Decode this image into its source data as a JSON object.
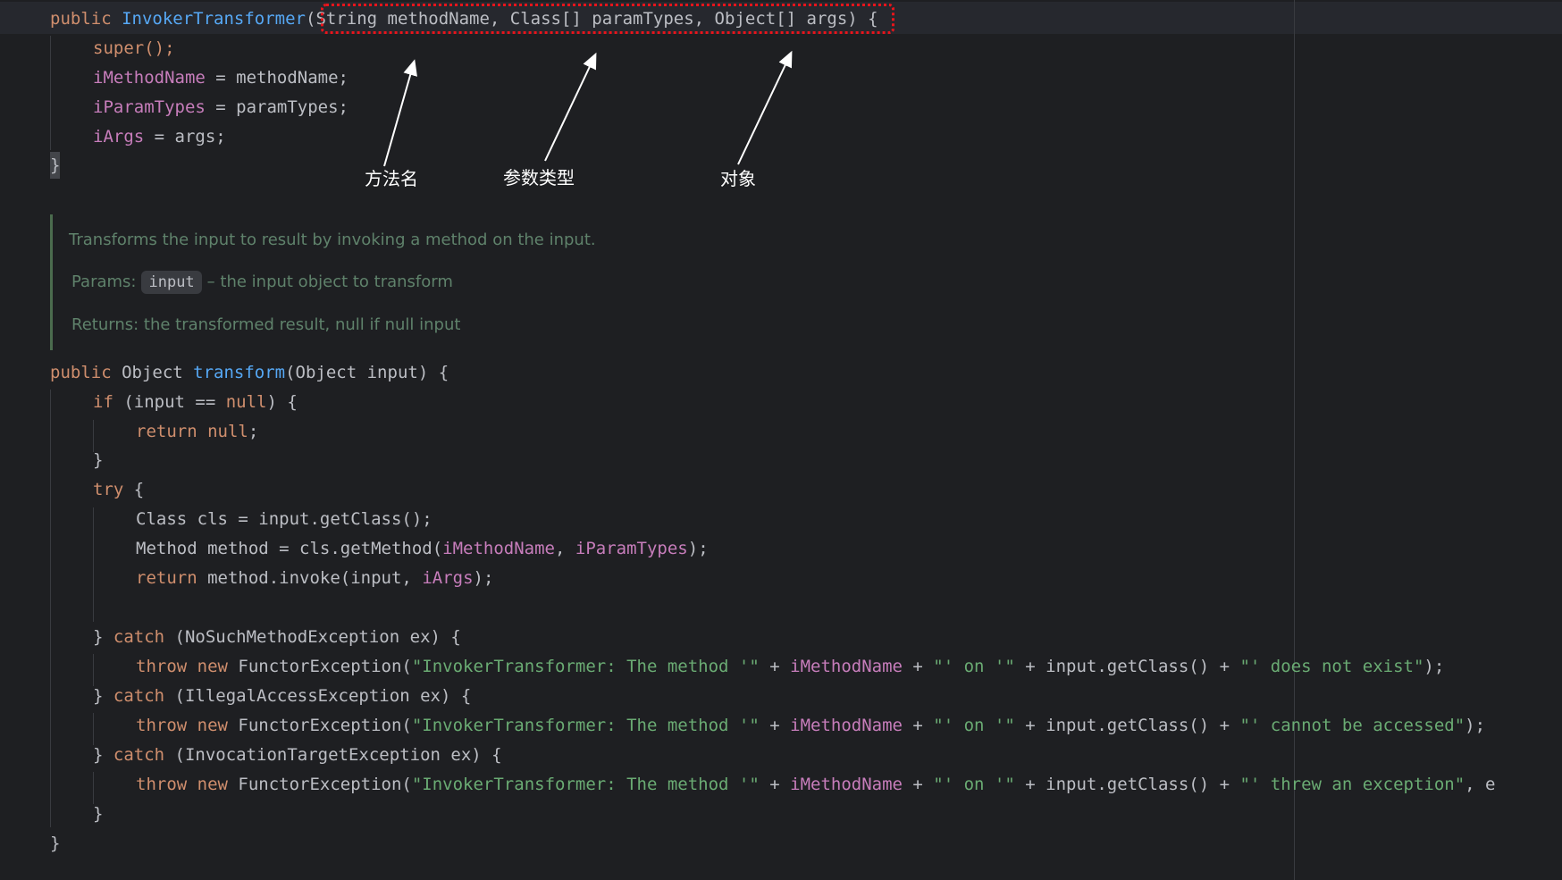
{
  "code": {
    "l1": {
      "kw": "public ",
      "fn": "InvokerTransformer",
      "p1": "(",
      "params": "String methodName, Class[] paramTypes, Object[] args",
      "p2": ")",
      "tail": " {"
    },
    "l2": {
      "text": "super();"
    },
    "l3": {
      "field": "iMethodName",
      "rest": " = methodName;"
    },
    "l4": {
      "field": "iParamTypes",
      "rest": " = paramTypes;"
    },
    "l5": {
      "field": "iArgs",
      "rest": " = args;"
    },
    "l6": {
      "text": "}"
    },
    "doc": {
      "summary": "Transforms the input to result by invoking a method on the input.",
      "params_label": "Params:",
      "param_name": "input",
      "param_desc": "– the input object to transform",
      "returns": "Returns: the transformed result, null if null input"
    },
    "l7": {
      "kw1": "public ",
      "type": "Object ",
      "fn": "transform",
      "rest": "(Object input) {"
    },
    "l8": {
      "kw": "if",
      "a": " (input == ",
      "kw2": "null",
      "b": ") {"
    },
    "l9": {
      "kw": "return null",
      "b": ";"
    },
    "l10": {
      "text": "}"
    },
    "l11": {
      "kw": "try",
      "b": " {"
    },
    "l12": {
      "text": "Class cls = input.getClass();"
    },
    "l13": {
      "a": "Method method = cls.getMethod(",
      "f1": "iMethodName",
      "c": ", ",
      "f2": "iParamTypes",
      "d": ");"
    },
    "l14": {
      "kw": "return",
      "a": " method.invoke(input, ",
      "f": "iArgs",
      "b": ");"
    },
    "l15": {
      "a": "} ",
      "kw": "catch",
      "b": " (NoSuchMethodException ex) {"
    },
    "l16": {
      "kw": "throw new",
      "a": " FunctorException(",
      "s1": "\"InvokerTransformer: The method '\"",
      "b": " + ",
      "f": "iMethodName",
      "c": " + ",
      "s2": "\"' on '\"",
      "d": " + input.getClass() + ",
      "s3": "\"' does not exist\"",
      "e": ");"
    },
    "l17": {
      "a": "} ",
      "kw": "catch",
      "b": " (IllegalAccessException ex) {"
    },
    "l18": {
      "kw": "throw new",
      "a": " FunctorException(",
      "s1": "\"InvokerTransformer: The method '\"",
      "b": " + ",
      "f": "iMethodName",
      "c": " + ",
      "s2": "\"' on '\"",
      "d": " + input.getClass() + ",
      "s3": "\"' cannot be accessed\"",
      "e": ");"
    },
    "l19": {
      "a": "} ",
      "kw": "catch",
      "b": " (InvocationTargetException ex) {"
    },
    "l20": {
      "kw": "throw new",
      "a": " FunctorException(",
      "s1": "\"InvokerTransformer: The method '\"",
      "b": " + ",
      "f": "iMethodName",
      "c": " + ",
      "s2": "\"' on '\"",
      "d": " + input.getClass() + ",
      "s3": "\"' threw an exception\"",
      "e": ", e"
    },
    "l21": {
      "text": "}"
    },
    "l22": {
      "text": "}"
    }
  },
  "annotations": {
    "method_name": "方法名",
    "param_types": "参数类型",
    "object": "对象"
  },
  "colors": {
    "background": "#1e1f22",
    "keyword": "#cf8e6d",
    "function": "#56a8f5",
    "field": "#c77dbb",
    "string": "#6aab73",
    "highlight_box": "#e8141b"
  }
}
